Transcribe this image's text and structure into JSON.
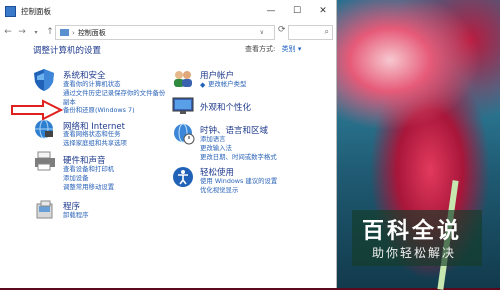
{
  "window": {
    "title": "控制面板"
  },
  "address": {
    "path": "控制面板",
    "search_placeholder": ""
  },
  "main": {
    "heading": "调整计算机的设置",
    "view_by_label": "查看方式:",
    "view_by_value": "类别 ▾"
  },
  "categories": [
    {
      "title": "系统和安全",
      "links": [
        "查看你的计算机状态",
        "通过文件历史记录保存你的文件备份",
        "副本",
        "备份和还原(Windows 7)"
      ]
    },
    {
      "title": "网络和 Internet",
      "links": [
        "查看网络状态和任务",
        "选择家庭组和共享选项"
      ]
    },
    {
      "title": "硬件和声音",
      "links": [
        "查看设备和打印机",
        "添加设备",
        "调整常用移动设置"
      ]
    },
    {
      "title": "程序",
      "links": [
        "卸载程序"
      ]
    },
    {
      "title": "用户帐户",
      "links": [
        "更改帐户类型"
      ]
    },
    {
      "title": "外观和个性化",
      "links": []
    },
    {
      "title": "时钟、语言和区域",
      "links": [
        "添加语言",
        "更改输入法",
        "更改日期、时间或数字格式"
      ]
    },
    {
      "title": "轻松使用",
      "links": [
        "使用 Windows 建议的设置",
        "优化视觉显示"
      ]
    }
  ],
  "watermark": {
    "title": "百科全说",
    "subtitle": "助你轻松解决"
  },
  "colors": {
    "link": "#2a63b8",
    "heading": "#1e3a8c",
    "arrow": "#e0201f"
  }
}
